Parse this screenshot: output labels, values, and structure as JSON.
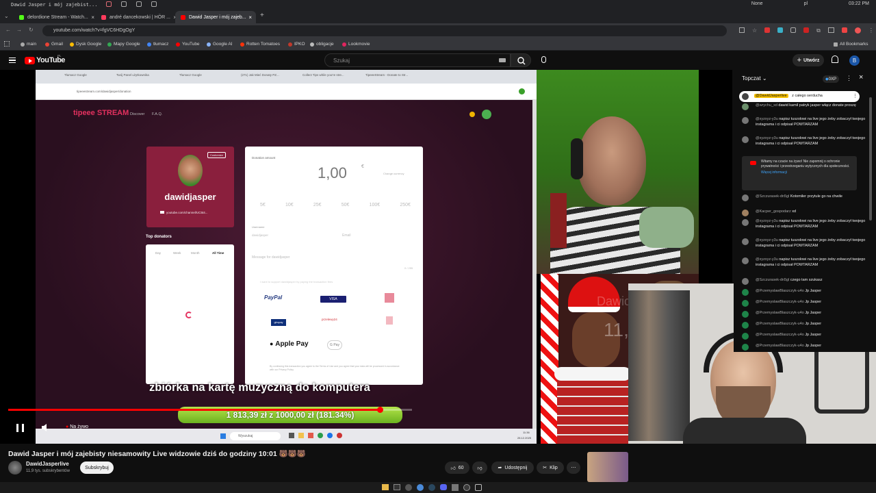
{
  "os": {
    "window_title": "Dawid Jasper i mój zajebist...",
    "user": "None",
    "lang": "pl",
    "time": "03:22 PM"
  },
  "tabs": [
    {
      "label": "delordione Stream - Watch...",
      "color": "#53fc18",
      "active": false
    },
    {
      "label": "andré dancekowski | HÖR ...",
      "color": "#ff3b5c",
      "active": false
    },
    {
      "label": "Dawid Jasper i mój zajeb...",
      "color": "#ff0000",
      "active": true
    }
  ],
  "address": {
    "url": "youtube.com/watch?v=fgVC6HDgOgY"
  },
  "bookmarks": [
    {
      "label": "main",
      "color": "#aaaaaa"
    },
    {
      "label": "Gmail",
      "color": "#ea4335"
    },
    {
      "label": "Dysk Google",
      "color": "#fbbc04"
    },
    {
      "label": "Mapy Google",
      "color": "#34a853"
    },
    {
      "label": "tłumacz",
      "color": "#4285f4"
    },
    {
      "label": "YouTube",
      "color": "#ff0000"
    },
    {
      "label": "Google AI",
      "color": "#8ab4f8"
    },
    {
      "label": "Rotten Tomatoes",
      "color": "#fa320a"
    },
    {
      "label": "IPKO",
      "color": "#c0392b"
    },
    {
      "label": "obligacje",
      "color": "#bbbbbb"
    },
    {
      "label": "Lookmovie",
      "color": "#e0245e"
    }
  ],
  "bookmarks_all": "All Bookmarks",
  "yt": {
    "logo": "YouTube",
    "logo_region": "PL",
    "search_placeholder": "Szukaj",
    "create_label": "Utwórz",
    "avatar_letter": "B"
  },
  "stream": {
    "inner_tabs": [
      "Tłumacz Google",
      "Twój Panel użytkownika",
      "Tłumacz Google",
      "(271) Jak Mieć Donaty PZ...",
      "Collect Tips while you're stre...",
      "TipeeeStream - Donate to Str..."
    ],
    "inner_url": "tipeeestream.com/dawidjasper/donation",
    "site_logo": "tipeee STREAM",
    "site_nav": [
      "Discover",
      "F.A.Q."
    ],
    "streamer_name": "dawidjasper",
    "customize_label": "Customize",
    "channel_link": "youtube.com/channel/UC5t4...",
    "top_donators": "Top donators",
    "donator_tabs": [
      "Day",
      "Week",
      "Month",
      "All Time"
    ],
    "donation_amount_label": "Donation amount",
    "amount": "1,00",
    "currency": "€",
    "currency_change": "Change currency",
    "presets": [
      "5€",
      "10€",
      "25€",
      "50€",
      "100€",
      "250€"
    ],
    "username_label": "Username",
    "username_value": "dawidjasper",
    "email_placeholder": "Email",
    "message_placeholder": "Message for dawidjasper",
    "message_count": "0 / 255",
    "fees_label": "I want to support dawidjasper by paying the transaction fees",
    "pay_methods": [
      "PayPal",
      "VISA",
      "",
      "giropay",
      "przelewy24",
      "",
      "Apple Pay",
      "G Pay"
    ],
    "terms_note": "By continuing this transaction you agree to the Terms of Use and you agree that your data will be processed in accordance with our Privacy Policy",
    "overlay_title": "zbiórka na kartę muzyczną do komputera",
    "goal_text": "1 813,39 zł z 1000,00 zł (181.34%)",
    "goal_progress": 1.0,
    "taskbar_search": "Wyszukaj",
    "taskbar_time": "11:36",
    "taskbar_date": "28.12.2025",
    "overlay_count": "11,946",
    "overlay_name": "Dawid"
  },
  "player": {
    "live_label": "Na żywo",
    "progress": 0.92
  },
  "chat": {
    "header": "Topczat",
    "points": "0XP",
    "pinned_author": "@DawidJasperlive",
    "pinned_text": "z całego serducha",
    "messages": [
      {
        "author": "@wrychu_xd",
        "text": "dawid kamil patryk jasper włącz donate proszę",
        "color": "#6b8e6b"
      },
      {
        "author": "@xyzxyz-y3u",
        "text": "napisz tuszolowi na live jego żeby zobaczył twojego instagrama i ci odpisał POWTARZAM",
        "color": "#8a8a8a"
      },
      {
        "author": "@xyzxyz-y3u",
        "text": "napisz tuszolowi na live jego żeby zobaczył twojego instagrama i ci odpisał POWTARZAM",
        "color": "#8a8a8a"
      }
    ],
    "system_notice": "Witamy na czacie na żywo! Nie zapomnij o ochronie prywatności i przestrzeganiu wytycznych dla społeczności.",
    "system_link": "Więcej informacji",
    "messages2": [
      {
        "author": "@Szczurasek-dn5gl",
        "text": "Kotomiler przytule go na chwile",
        "color": "#8a8a8a"
      },
      {
        "author": "@Kacper_gospodarz",
        "text": "xd",
        "color": "#a08060"
      },
      {
        "author": "@xyzxyz-y3u",
        "text": "napisz tuszolowi na live jego żeby zobaczył twojego instagrama i ci odpisał POWTARZAM",
        "color": "#8a8a8a"
      },
      {
        "author": "@xyzxyz-y3u",
        "text": "napisz tuszolowi na live jego żeby zobaczył twojego instagrama i ci odpisał POWTARZAM",
        "color": "#8a8a8a"
      },
      {
        "author": "@xyzxyz-y3u",
        "text": "napisz tuszolowi na live jego żeby zobaczył twojego instagrama i ci odpisał POWTARZAM",
        "color": "#8a8a8a"
      },
      {
        "author": "@Szczurasek-dn5gl",
        "text": "czego tam szukasz",
        "color": "#8a8a8a"
      },
      {
        "author": "@PrzemyslawBlaszczyk-u4o",
        "text": "Jp Jasper",
        "color": "#1e8449"
      },
      {
        "author": "@PrzemyslawBlaszczyk-u4o",
        "text": "Jp Jasper",
        "color": "#1e8449"
      },
      {
        "author": "@PrzemyslawBlaszczyk-u4o",
        "text": "Jp Jasper",
        "color": "#1e8449"
      },
      {
        "author": "@PrzemyslawBlaszczyk-u4o",
        "text": "Jp Jasper",
        "color": "#1e8449"
      },
      {
        "author": "@PrzemyslawBlaszczyk-u4o",
        "text": "Jp Jasper",
        "color": "#1e8449"
      },
      {
        "author": "@PrzemyslawBlaszczyk-u4o",
        "text": "Jp Jasper",
        "color": "#1e8449"
      }
    ]
  },
  "video": {
    "title": "Dawid Jasper i mój zajebisty niesamowity Live widzowie dziś do godziny 10:01 🐻🐻🐻",
    "channel": "DawidJasperlive",
    "subscribers": "11,9 tys. subskrybentów",
    "subscribe_label": "Subskrybuj",
    "likes": "60",
    "share_label": "Udostępnij",
    "clip_label": "Klip"
  },
  "colors": {
    "accent": "#ff0000",
    "goal_green": "#8fd12f",
    "chat_bg": "#0f0f0f"
  }
}
